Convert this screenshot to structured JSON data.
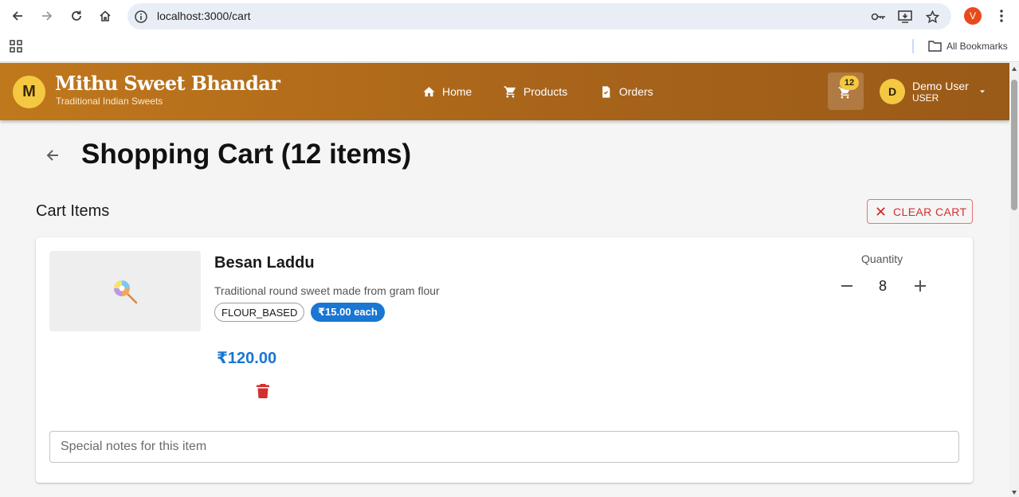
{
  "browser": {
    "url": "localhost:3000/cart",
    "profile_initial": "V",
    "bookmarks_label": "All Bookmarks"
  },
  "header": {
    "logo_letter": "M",
    "brand_name": "Mithu Sweet Bhandar",
    "tagline": "Traditional Indian Sweets",
    "nav": [
      {
        "label": "Home",
        "icon": "home-icon"
      },
      {
        "label": "Products",
        "icon": "cart-icon"
      },
      {
        "label": "Orders",
        "icon": "receipt-icon"
      }
    ],
    "cart_badge": "12",
    "user": {
      "initial": "D",
      "name": "Demo User",
      "role": "USER"
    }
  },
  "page": {
    "title": "Shopping Cart (12 items)",
    "section_title": "Cart Items",
    "clear_label": "CLEAR CART"
  },
  "cart": {
    "items": [
      {
        "name": "Besan Laddu",
        "description": "Traditional round sweet made from gram flour",
        "category": "FLOUR_BASED",
        "unit_price": "₹15.00 each",
        "total": "₹120.00",
        "quantity_label": "Quantity",
        "quantity": "8",
        "notes_placeholder": "Special notes for this item",
        "image_icon": "lollipop-icon"
      }
    ]
  },
  "colors": {
    "header_start": "#c0781c",
    "header_end": "#9a5a18",
    "accent_yellow": "#f5c842",
    "primary_blue": "#1976d2",
    "danger_red": "#d32f2f"
  }
}
